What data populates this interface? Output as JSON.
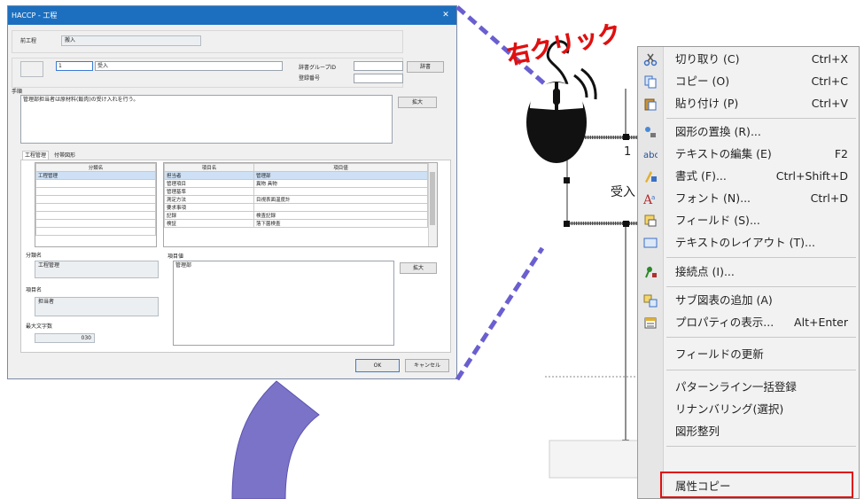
{
  "dialog": {
    "title": "HACCP - 工程",
    "close_glyph": "✕",
    "prev_process_label": "前工程",
    "prev_process_value": "搬入",
    "step_number": "1",
    "step_name": "受入",
    "dict_group_label": "辞書グループID",
    "registration_no_label": "登録番号",
    "dict_button": "辞書",
    "procedure_label": "手順",
    "procedure_text": "管理部担当者は原材料(飯肉)の受け入れを行う。",
    "expand_button": "拡大",
    "tabs": [
      "工程管理",
      "付帯図形"
    ],
    "class_table": {
      "header": "分類名",
      "rows": [
        "工程管理",
        "",
        "",
        "",
        "",
        "",
        "",
        ""
      ]
    },
    "item_table": {
      "headers": [
        "項目名",
        "項目値"
      ],
      "rows": [
        [
          "担当者",
          "管理部"
        ],
        [
          "管理項目",
          "異物 具物"
        ],
        [
          "管理基準",
          ""
        ],
        [
          "測定方法",
          "目視表面温度計"
        ],
        [
          "要求事項",
          ""
        ],
        [
          "記録",
          "検査記録"
        ],
        [
          "検証",
          "落下菌検査"
        ]
      ]
    },
    "class_name_label": "分類名",
    "class_name_value": "工程管理",
    "item_name_label": "項目名",
    "item_name_value": "担当者",
    "max_chars_label": "最大文字数",
    "max_chars_value": "030",
    "item_value_label": "項目値",
    "item_value_text": "管理部",
    "ok_button": "OK",
    "cancel_button": "キャンセル"
  },
  "annotation": {
    "right_click": "右クリック",
    "accent": "#6a5fd0",
    "arrow_color": "#7b73c8"
  },
  "canvas": {
    "shape_number": "1",
    "shape_label": "受入"
  },
  "context_menu": {
    "items": [
      {
        "icon": "scissors-icon",
        "label": "切り取り",
        "mnemonic": "(C)",
        "shortcut": "Ctrl+X"
      },
      {
        "icon": "copy-icon",
        "label": "コピー",
        "mnemonic": "(O)",
        "shortcut": "Ctrl+C"
      },
      {
        "icon": "paste-icon",
        "label": "貼り付け",
        "mnemonic": "(P)",
        "shortcut": "Ctrl+V"
      },
      {
        "icon": "replace-shape-icon",
        "label": "図形の置換",
        "mnemonic": "(R)...",
        "shortcut": ""
      },
      {
        "icon": "edit-text-icon",
        "label": "テキストの編集",
        "mnemonic": "(E)",
        "shortcut": "F2"
      },
      {
        "icon": "format-icon",
        "label": "書式",
        "mnemonic": "(F)...",
        "shortcut": "Ctrl+Shift+D"
      },
      {
        "icon": "font-icon",
        "label": "フォント",
        "mnemonic": "(N)...",
        "shortcut": "Ctrl+D"
      },
      {
        "icon": "field-icon",
        "label": "フィールド",
        "mnemonic": "(S)...",
        "shortcut": ""
      },
      {
        "icon": "text-layout-icon",
        "label": "テキストのレイアウト",
        "mnemonic": "(T)...",
        "shortcut": ""
      },
      {
        "icon": "connection-point-icon",
        "label": "接続点",
        "mnemonic": "(I)...",
        "shortcut": ""
      },
      {
        "icon": "add-subdiagram-icon",
        "label": "サブ図表の追加",
        "mnemonic": "(A)",
        "shortcut": ""
      },
      {
        "icon": "properties-icon",
        "label": "プロパティの表示...",
        "mnemonic": "",
        "shortcut": "Alt+Enter"
      },
      {
        "icon": "",
        "label": "フィールドの更新",
        "mnemonic": "",
        "shortcut": ""
      },
      {
        "icon": "",
        "label": "パターンライン一括登録",
        "mnemonic": "",
        "shortcut": ""
      },
      {
        "icon": "",
        "label": "リナンバリング(選択)",
        "mnemonic": "",
        "shortcut": ""
      },
      {
        "icon": "",
        "label": "図形整列",
        "mnemonic": "",
        "shortcut": ""
      },
      {
        "icon": "",
        "label": "属性コピー",
        "mnemonic": "",
        "shortcut": ""
      }
    ],
    "highlight_color": "#e01010"
  }
}
